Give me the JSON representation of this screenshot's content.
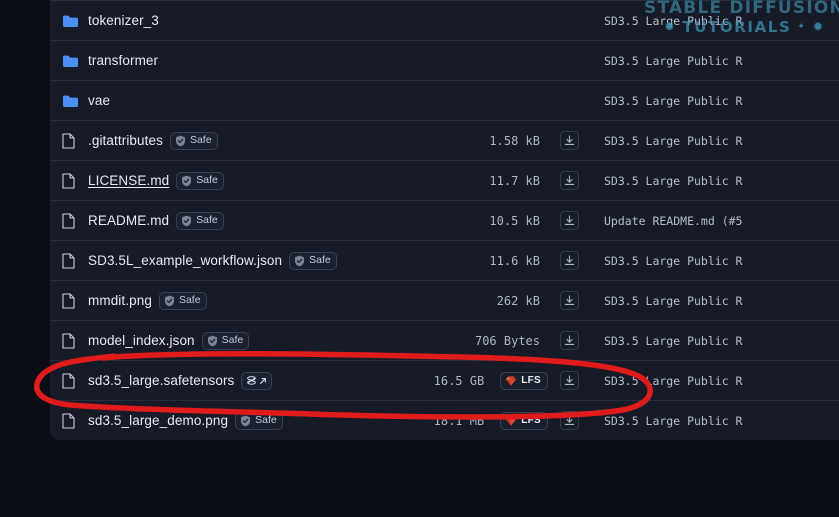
{
  "colors": {
    "page_bg": "#0b0d14",
    "row_bg": "#161b27",
    "row_border": "#262d3c",
    "folder_blue": "#4a90f7",
    "lfs_red": "#e0452f",
    "annotation_red": "#e01b1b",
    "watermark_teal": "#3f96b4",
    "text_primary": "#e6eaf2",
    "text_muted": "#aeb6c6"
  },
  "watermark": {
    "line1": "STABLE DIFFUSION",
    "line2": "TUTORIALS",
    "star_left": "✹",
    "star_right": "✹",
    "star_small": "✦"
  },
  "annotation": {
    "type": "hand-drawn-ellipse",
    "target_row": "sd3.5_large.safetensors",
    "color": "#e01b1b"
  },
  "file_table": {
    "rows": [
      {
        "icon": "folder-icon",
        "name": "tokenizer_3",
        "is_link": false,
        "badge": null,
        "size": "",
        "lfs": false,
        "download": false,
        "commit": "SD3.5 Large Public R"
      },
      {
        "icon": "folder-icon",
        "name": "transformer",
        "is_link": false,
        "badge": null,
        "size": "",
        "lfs": false,
        "download": false,
        "commit": "SD3.5 Large Public R"
      },
      {
        "icon": "folder-icon",
        "name": "vae",
        "is_link": false,
        "badge": null,
        "size": "",
        "lfs": false,
        "download": false,
        "commit": "SD3.5 Large Public R"
      },
      {
        "icon": "file-icon",
        "name": ".gitattributes",
        "is_link": false,
        "badge": "Safe",
        "size": "1.58 kB",
        "lfs": false,
        "download": true,
        "commit": "SD3.5 Large Public R"
      },
      {
        "icon": "file-icon",
        "name": "LICENSE.md",
        "is_link": true,
        "badge": "Safe",
        "size": "11.7 kB",
        "lfs": false,
        "download": true,
        "commit": "SD3.5 Large Public R"
      },
      {
        "icon": "file-icon",
        "name": "README.md",
        "is_link": false,
        "badge": "Safe",
        "size": "10.5 kB",
        "lfs": false,
        "download": true,
        "commit": "Update README.md (#5"
      },
      {
        "icon": "file-icon",
        "name": "SD3.5L_example_workflow.json",
        "is_link": false,
        "badge": "Safe",
        "size": "11.6 kB",
        "lfs": false,
        "download": true,
        "commit": "SD3.5 Large Public R"
      },
      {
        "icon": "file-icon",
        "name": "mmdit.png",
        "is_link": false,
        "badge": "Safe",
        "size": "262 kB",
        "lfs": false,
        "download": true,
        "commit": "SD3.5 Large Public R"
      },
      {
        "icon": "file-icon",
        "name": "model_index.json",
        "is_link": false,
        "badge": "Safe",
        "size": "706 Bytes",
        "lfs": false,
        "download": true,
        "commit": "SD3.5 Large Public R"
      },
      {
        "icon": "file-icon",
        "name": "sd3.5_large.safetensors",
        "is_link": false,
        "badge": "xet",
        "size": "16.5 GB",
        "lfs": true,
        "lfs_label": "LFS",
        "download": true,
        "commit": "SD3.5 Large Public R",
        "highlighted": true
      },
      {
        "icon": "file-icon",
        "name": "sd3.5_large_demo.png",
        "is_link": false,
        "badge": "Safe",
        "size": "18.1 MB",
        "lfs": true,
        "lfs_label": "LFS",
        "download": true,
        "commit": "SD3.5 Large Public R"
      }
    ]
  }
}
